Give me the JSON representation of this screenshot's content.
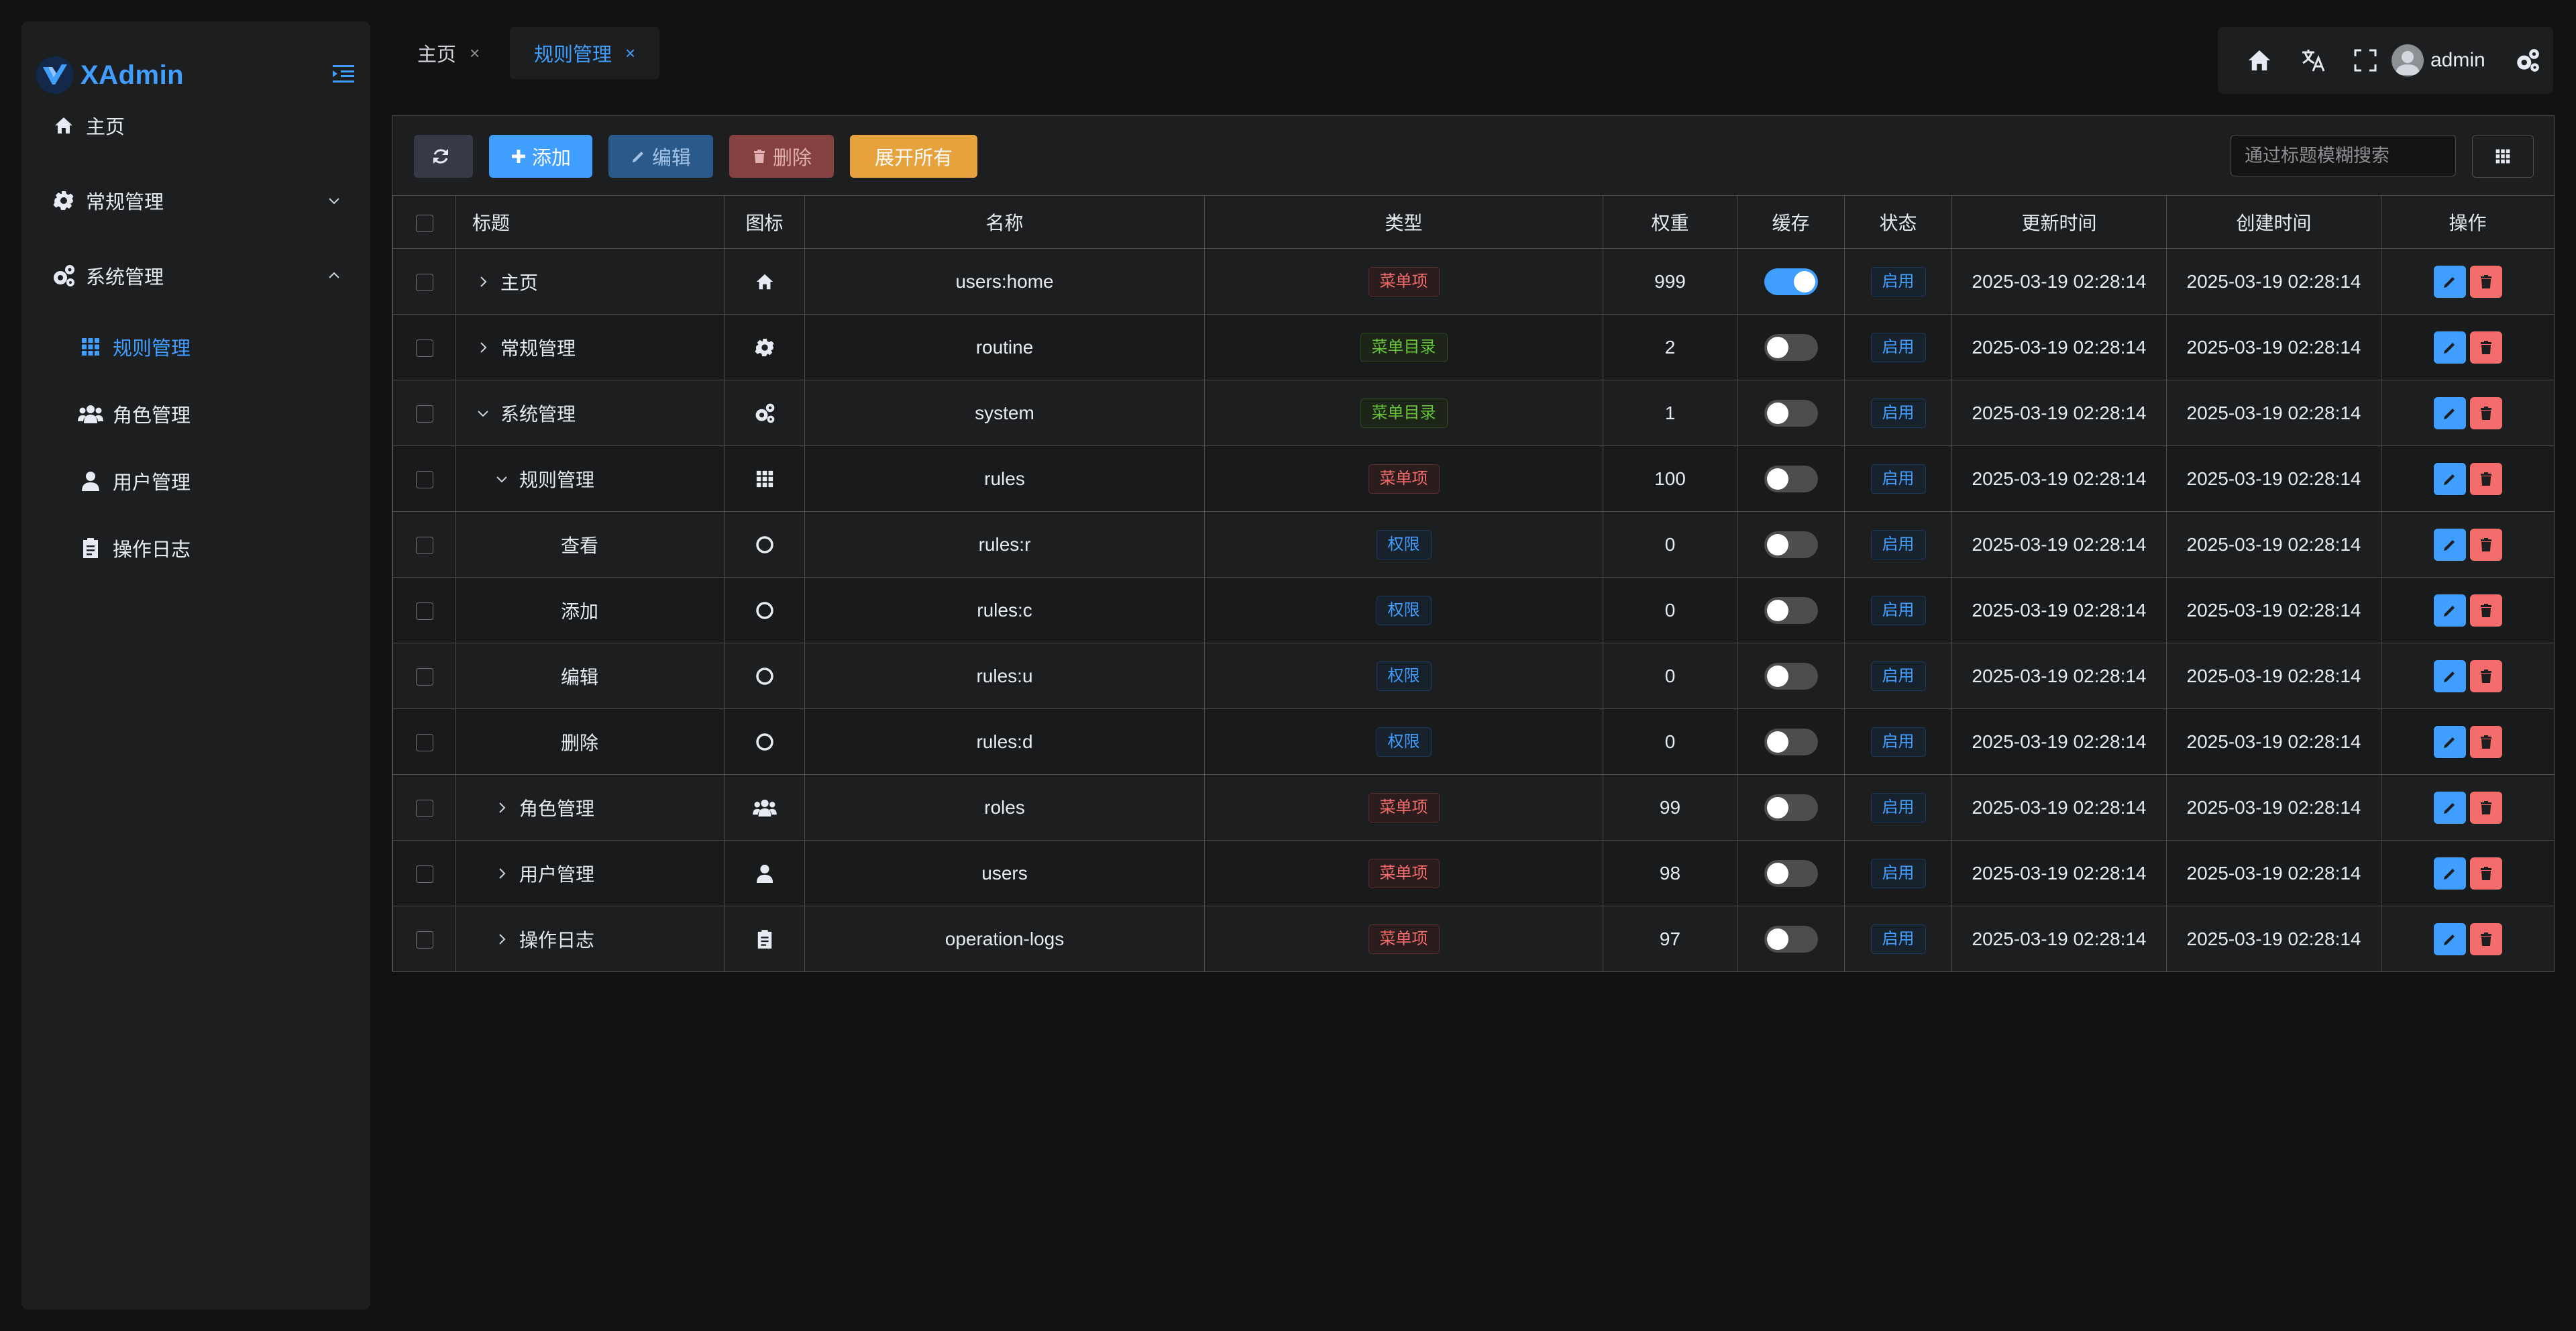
{
  "app": {
    "name": "XAdmin"
  },
  "sidebar": {
    "items": [
      {
        "label": "主页",
        "icon": "home-icon"
      },
      {
        "label": "常规管理",
        "icon": "gear-icon",
        "expanded": false
      },
      {
        "label": "系统管理",
        "icon": "gears-icon",
        "expanded": true
      },
      {
        "label": "规则管理",
        "icon": "grid-icon",
        "active": true
      },
      {
        "label": "角色管理",
        "icon": "users-icon"
      },
      {
        "label": "用户管理",
        "icon": "user-icon"
      },
      {
        "label": "操作日志",
        "icon": "clipboard-icon"
      }
    ]
  },
  "tabs": [
    {
      "label": "主页",
      "close": "×"
    },
    {
      "label": "规则管理",
      "close": "×",
      "active": true
    }
  ],
  "header": {
    "username": "admin"
  },
  "toolbar": {
    "add_label": "添加",
    "edit_label": "编辑",
    "delete_label": "删除",
    "expand_label": "展开所有",
    "search_placeholder": "通过标题模糊搜索"
  },
  "table": {
    "columns": [
      "标题",
      "图标",
      "名称",
      "类型",
      "权重",
      "缓存",
      "状态",
      "更新时间",
      "创建时间",
      "操作"
    ],
    "rows": [
      {
        "title": "主页",
        "icon": "home-icon",
        "name": "users:home",
        "type": "菜单项",
        "type_color": "red",
        "weight": "999",
        "cache": true,
        "status": "启用",
        "updated": "2025-03-19 02:28:14",
        "created": "2025-03-19 02:28:14",
        "level": 0,
        "expander": "collapsed"
      },
      {
        "title": "常规管理",
        "icon": "gear-icon",
        "name": "routine",
        "type": "菜单目录",
        "type_color": "green",
        "weight": "2",
        "cache": false,
        "status": "启用",
        "updated": "2025-03-19 02:28:14",
        "created": "2025-03-19 02:28:14",
        "level": 0,
        "expander": "collapsed"
      },
      {
        "title": "系统管理",
        "icon": "gears-icon",
        "name": "system",
        "type": "菜单目录",
        "type_color": "green",
        "weight": "1",
        "cache": false,
        "status": "启用",
        "updated": "2025-03-19 02:28:14",
        "created": "2025-03-19 02:28:14",
        "level": 0,
        "expander": "expanded"
      },
      {
        "title": "规则管理",
        "icon": "grid-icon",
        "name": "rules",
        "type": "菜单项",
        "type_color": "red",
        "weight": "100",
        "cache": false,
        "status": "启用",
        "updated": "2025-03-19 02:28:14",
        "created": "2025-03-19 02:28:14",
        "level": 1,
        "expander": "expanded"
      },
      {
        "title": "查看",
        "icon": "circle-icon",
        "name": "rules:r",
        "type": "权限",
        "type_color": "blue",
        "weight": "0",
        "cache": false,
        "status": "启用",
        "updated": "2025-03-19 02:28:14",
        "created": "2025-03-19 02:28:14",
        "level": 2,
        "expander": "none"
      },
      {
        "title": "添加",
        "icon": "circle-icon",
        "name": "rules:c",
        "type": "权限",
        "type_color": "blue",
        "weight": "0",
        "cache": false,
        "status": "启用",
        "updated": "2025-03-19 02:28:14",
        "created": "2025-03-19 02:28:14",
        "level": 2,
        "expander": "none"
      },
      {
        "title": "编辑",
        "icon": "circle-icon",
        "name": "rules:u",
        "type": "权限",
        "type_color": "blue",
        "weight": "0",
        "cache": false,
        "status": "启用",
        "updated": "2025-03-19 02:28:14",
        "created": "2025-03-19 02:28:14",
        "level": 2,
        "expander": "none"
      },
      {
        "title": "删除",
        "icon": "circle-icon",
        "name": "rules:d",
        "type": "权限",
        "type_color": "blue",
        "weight": "0",
        "cache": false,
        "status": "启用",
        "updated": "2025-03-19 02:28:14",
        "created": "2025-03-19 02:28:14",
        "level": 2,
        "expander": "none"
      },
      {
        "title": "角色管理",
        "icon": "users-icon",
        "name": "roles",
        "type": "菜单项",
        "type_color": "red",
        "weight": "99",
        "cache": false,
        "status": "启用",
        "updated": "2025-03-19 02:28:14",
        "created": "2025-03-19 02:28:14",
        "level": 1,
        "expander": "collapsed"
      },
      {
        "title": "用户管理",
        "icon": "user-icon",
        "name": "users",
        "type": "菜单项",
        "type_color": "red",
        "weight": "98",
        "cache": false,
        "status": "启用",
        "updated": "2025-03-19 02:28:14",
        "created": "2025-03-19 02:28:14",
        "level": 1,
        "expander": "collapsed"
      },
      {
        "title": "操作日志",
        "icon": "clipboard-icon",
        "name": "operation-logs",
        "type": "菜单项",
        "type_color": "red",
        "weight": "97",
        "cache": false,
        "status": "启用",
        "updated": "2025-03-19 02:28:14",
        "created": "2025-03-19 02:28:14",
        "level": 1,
        "expander": "collapsed"
      }
    ]
  },
  "colors": {
    "accent": "#409eff",
    "danger": "#f56c6c",
    "success": "#67c23a",
    "warning": "#e6a23c"
  }
}
